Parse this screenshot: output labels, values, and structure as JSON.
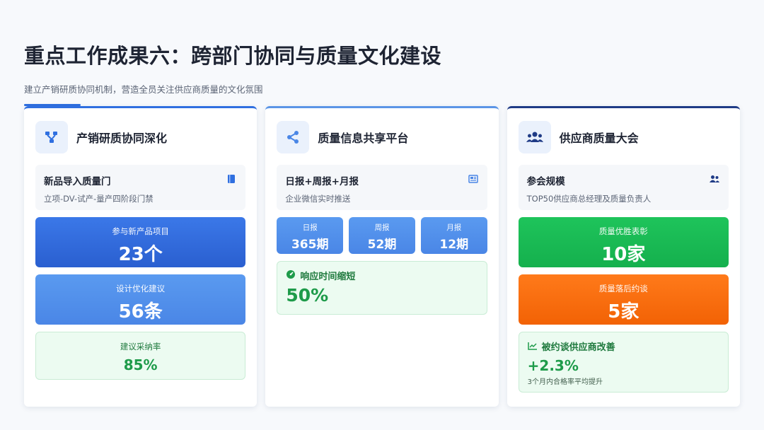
{
  "header": {
    "title": "重点工作成果六：跨部门协同与质量文化建设",
    "subtitle": "建立产销研质协同机制，营造全员关注供应商质量的文化氛围"
  },
  "colors": {
    "accent": "#2f6fe0",
    "green": "#1e9b4a",
    "orange": "#f26205"
  },
  "card1": {
    "title": "产销研质协同深化",
    "icon": "network-icon",
    "info": {
      "title": "新品导入质量门",
      "sub": "立项-DV-试产-量产四阶段门禁",
      "icon": "book-icon"
    },
    "stat1": {
      "label": "参与新产品项目",
      "value": "23个"
    },
    "stat2": {
      "label": "设计优化建议",
      "value": "56条"
    },
    "stat3": {
      "label": "建议采纳率",
      "value": "85%"
    }
  },
  "card2": {
    "title": "质量信息共享平台",
    "icon": "share-icon",
    "info": {
      "title": "日报+周报+月报",
      "sub": "企业微信实时推送",
      "icon": "newspaper-icon"
    },
    "reports": [
      {
        "label": "日报",
        "value": "365期"
      },
      {
        "label": "周报",
        "value": "52期"
      },
      {
        "label": "月报",
        "value": "12期"
      }
    ],
    "response": {
      "label": "响应时间缩短",
      "value": "50%",
      "icon": "gauge-icon"
    }
  },
  "card3": {
    "title": "供应商质量大会",
    "icon": "users-icon",
    "info": {
      "title": "参会规模",
      "sub": "TOP50供应商总经理及质量负责人",
      "icon": "user-group-icon"
    },
    "stat1": {
      "label": "质量优胜表彰",
      "value": "10家"
    },
    "stat2": {
      "label": "质量落后约谈",
      "value": "5家"
    },
    "improve": {
      "label": "被约谈供应商改善",
      "value": "+2.3%",
      "note": "3个月内合格率平均提升",
      "icon": "trend-icon"
    }
  }
}
